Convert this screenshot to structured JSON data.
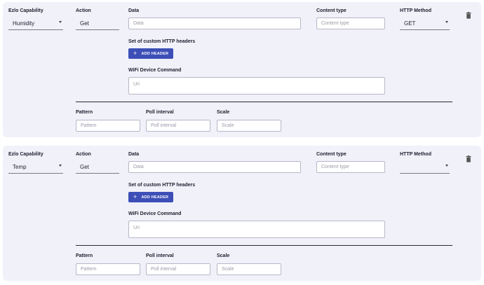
{
  "labels": {
    "capability": "Ezlo Capability",
    "action": "Action",
    "data": "Data",
    "content_type": "Content type",
    "http_method": "HTTP Method",
    "headers": "Set of custom HTTP headers",
    "add_header": "ADD HEADER",
    "wifi_command": "WiFi Device Command",
    "pattern": "Pattern",
    "poll_interval": "Poll interval",
    "scale": "Scale"
  },
  "placeholders": {
    "data": "Data",
    "content_type": "Content type",
    "uri": "Uri",
    "pattern": "Pattern",
    "poll_interval": "Poll interval",
    "scale": "Scale"
  },
  "icons": {
    "add": "plus-icon",
    "delete": "trash-icon",
    "dropdown": "caret-down-icon"
  },
  "colors": {
    "card_bg": "#f0f1f9",
    "button_bg": "#3d4fb7",
    "button_text": "#ffffff"
  },
  "commands": [
    {
      "capability": "Humidity",
      "action": "Get",
      "http_method": "GET"
    },
    {
      "capability": "Temp",
      "action": "Get",
      "http_method": ""
    }
  ]
}
